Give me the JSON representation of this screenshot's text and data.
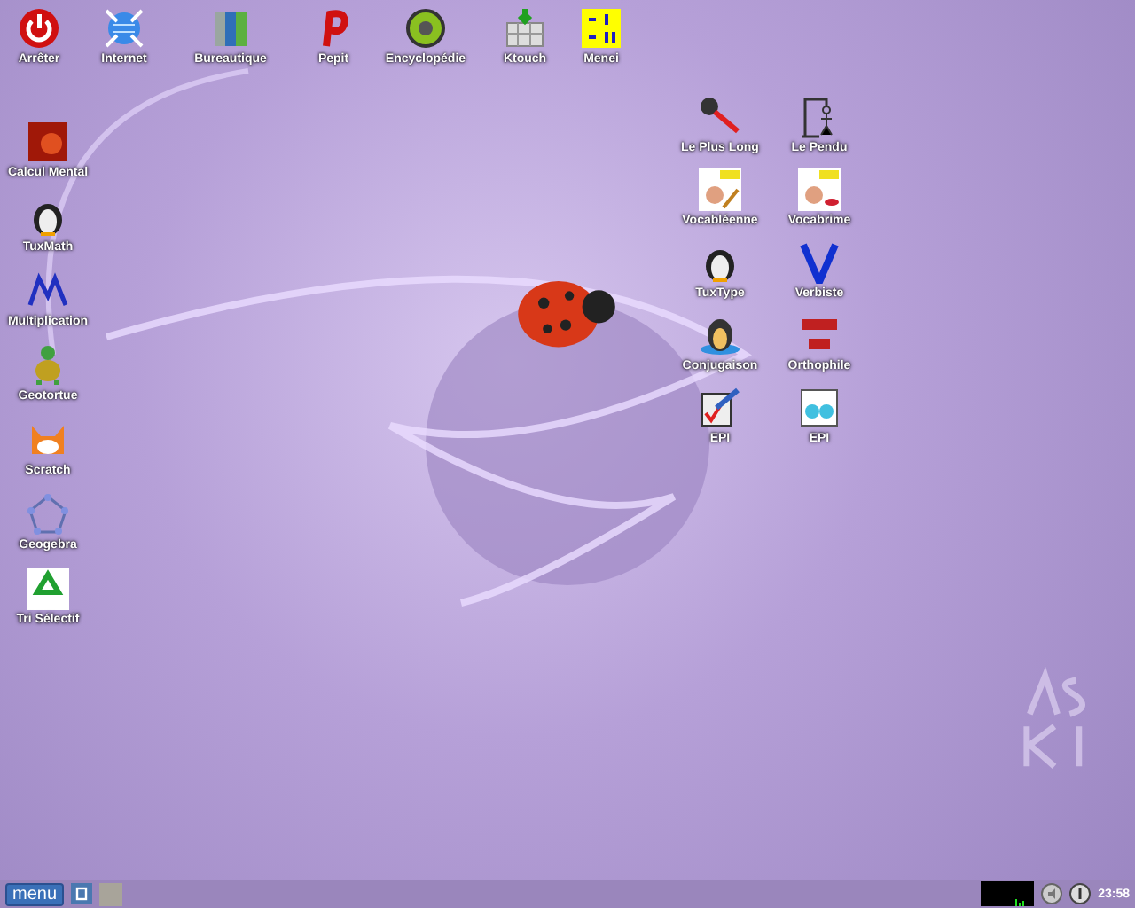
{
  "desktop": {
    "top_row": [
      {
        "label": "Arrêter"
      },
      {
        "label": "Internet"
      },
      {
        "label": "Bureautique"
      },
      {
        "label": "Pepit"
      },
      {
        "label": "Encyclopédie"
      },
      {
        "label": "Ktouch"
      },
      {
        "label": "Menei"
      }
    ],
    "left_column": [
      {
        "label": "Calcul Mental"
      },
      {
        "label": "TuxMath"
      },
      {
        "label": "Multiplication"
      },
      {
        "label": "Geotortue"
      },
      {
        "label": "Scratch"
      },
      {
        "label": "Geogebra"
      },
      {
        "label": "Tri Sélectif"
      }
    ],
    "right_grid": [
      {
        "label": "Le Plus Long"
      },
      {
        "label": "Le Pendu"
      },
      {
        "label": "Vocabléenne"
      },
      {
        "label": "Vocabrime"
      },
      {
        "label": "TuxType"
      },
      {
        "label": "Verbiste"
      },
      {
        "label": "Conjugaison"
      },
      {
        "label": "Orthophile"
      },
      {
        "label": "EPI"
      },
      {
        "label": "EPI"
      }
    ]
  },
  "taskbar": {
    "menu_button": "menu",
    "clock": "23:58"
  }
}
